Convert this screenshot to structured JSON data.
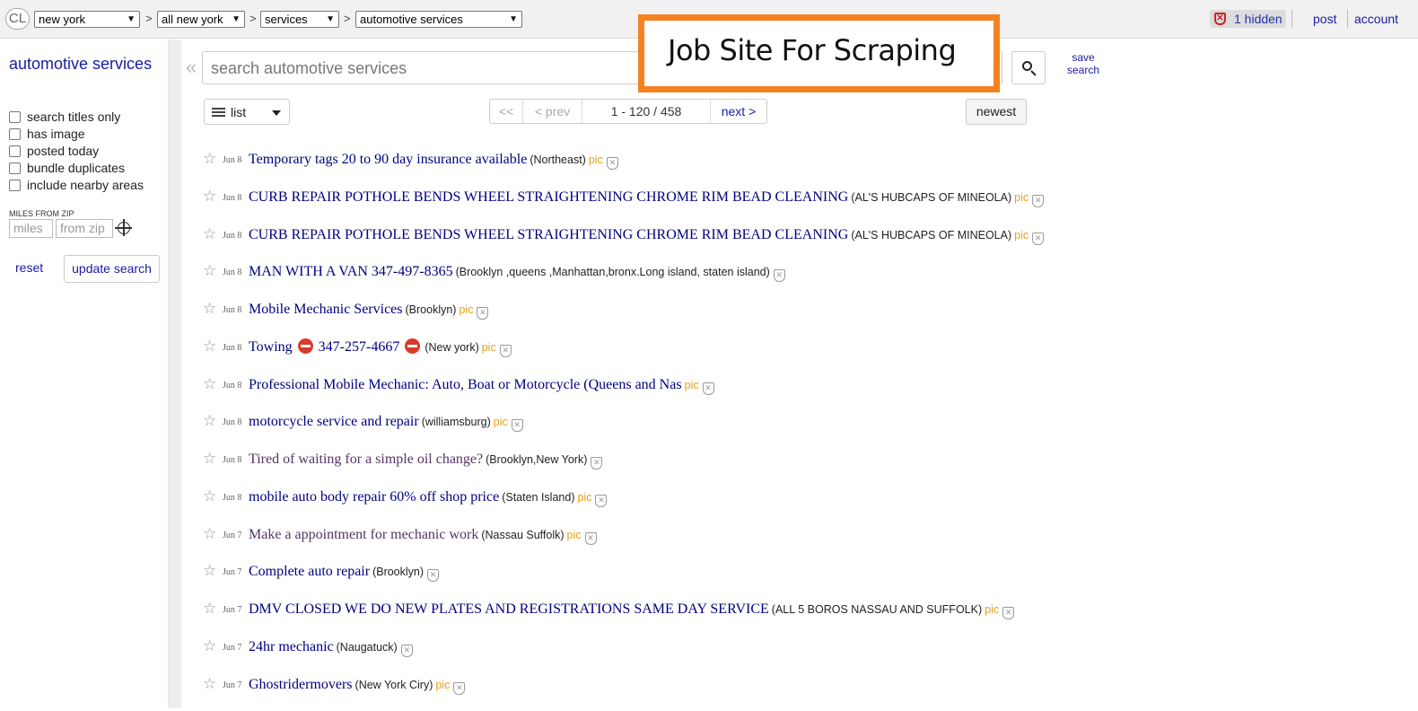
{
  "topbar": {
    "logo": "CL",
    "breadcrumbs": [
      {
        "label": "new york"
      },
      {
        "label": "all new york"
      },
      {
        "label": "services"
      },
      {
        "label": "automotive services"
      }
    ],
    "separator": ">",
    "hidden_label": "1 hidden",
    "post_label": "post",
    "account_label": "account"
  },
  "sidebar": {
    "category_title": "automotive services",
    "filters": [
      {
        "label": "search titles only",
        "checked": false
      },
      {
        "label": "has image",
        "checked": false
      },
      {
        "label": "posted today",
        "checked": false
      },
      {
        "label": "bundle duplicates",
        "checked": false
      },
      {
        "label": "include nearby areas",
        "checked": false
      }
    ],
    "miles_from_zip_label": "MILES FROM ZIP",
    "miles_placeholder": "miles",
    "zip_placeholder": "from zip",
    "reset_label": "reset",
    "update_label": "update search"
  },
  "search": {
    "collapse_glyph": "«",
    "placeholder": "search automotive services",
    "save_label_line1": "save",
    "save_label_line2": "search"
  },
  "overlay": {
    "text": "Job Site For Scraping",
    "border_color": "#f58220"
  },
  "toolbar": {
    "view_label": "list",
    "pager_first": "<<",
    "pager_prev": "< prev",
    "pager_count": "1 - 120 / 458",
    "pager_next": "next >",
    "sort_label": "newest"
  },
  "results": [
    {
      "date": "Jun 8",
      "title": "Temporary tags 20 to 90 day insurance available",
      "hood": "(Northeast)",
      "pic": "pic",
      "visited": false
    },
    {
      "date": "Jun 8",
      "title": "CURB REPAIR POTHOLE BENDS WHEEL STRAIGHTENING CHROME RIM BEAD CLEANING",
      "hood": "(AL'S HUBCAPS OF MINEOLA)",
      "pic": "pic",
      "visited": false
    },
    {
      "date": "Jun 8",
      "title": "CURB REPAIR POTHOLE BENDS WHEEL STRAIGHTENING CHROME RIM BEAD CLEANING",
      "hood": "(AL'S HUBCAPS OF MINEOLA)",
      "pic": "pic",
      "visited": false
    },
    {
      "date": "Jun 8",
      "title": "MAN WITH A VAN 347-497-8365",
      "hood": "(Brooklyn ,queens ,Manhattan,bronx.Long island, staten island)",
      "pic": "",
      "visited": false
    },
    {
      "date": "Jun 8",
      "title": "Mobile Mechanic Services",
      "hood": "(Brooklyn)",
      "pic": "pic",
      "visited": false
    },
    {
      "date": "Jun 8",
      "title_a": "Towing",
      "title_b": "347-257-4667",
      "hood": "(New york)",
      "pic": "pic",
      "visited": false,
      "stop_icons": true
    },
    {
      "date": "Jun 8",
      "title": "Professional Mobile Mechanic: Auto, Boat or Motorcycle (Queens and Nas",
      "hood": "",
      "pic": "pic",
      "visited": false
    },
    {
      "date": "Jun 8",
      "title": "motorcycle service and repair",
      "hood": "(williamsburg)",
      "pic": "pic",
      "visited": false
    },
    {
      "date": "Jun 8",
      "title": "Tired of waiting for a simple oil change?",
      "hood": "(Brooklyn,New York)",
      "pic": "",
      "visited": true
    },
    {
      "date": "Jun 8",
      "title": "mobile auto body repair 60% off shop price",
      "hood": "(Staten Island)",
      "pic": "pic",
      "visited": false
    },
    {
      "date": "Jun 7",
      "title": "Make a appointment for mechanic work",
      "hood": "(Nassau Suffolk)",
      "pic": "pic",
      "visited": true
    },
    {
      "date": "Jun 7",
      "title": "Complete auto repair",
      "hood": "(Brooklyn)",
      "pic": "",
      "visited": false
    },
    {
      "date": "Jun 7",
      "title": "DMV CLOSED WE DO NEW PLATES AND REGISTRATIONS SAME DAY SERVICE",
      "hood": "(ALL 5 BOROS NASSAU AND SUFFOLK)",
      "pic": "pic",
      "visited": false
    },
    {
      "date": "Jun 7",
      "title": "24hr mechanic",
      "hood": "(Naugatuck)",
      "pic": "",
      "visited": false
    },
    {
      "date": "Jun 7",
      "title": "Ghostridermovers",
      "hood": "(New York Ciry)",
      "pic": "pic",
      "visited": false
    }
  ],
  "icons": {
    "star": "☆",
    "hide": "✕"
  }
}
